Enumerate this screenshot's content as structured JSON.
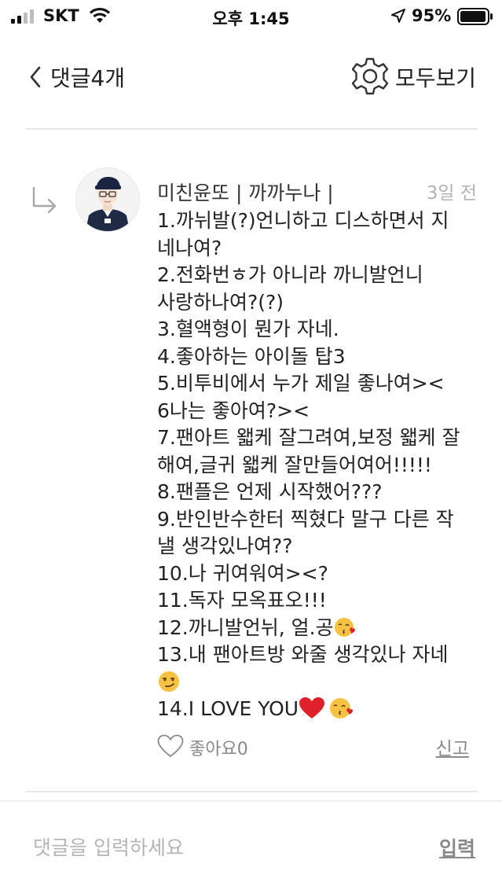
{
  "status_bar": {
    "carrier": "SKT",
    "time": "오후 1:45",
    "battery": "95%"
  },
  "header": {
    "title": "댓글4개",
    "view_all": "모두보기"
  },
  "comment": {
    "author": "미친윤또 | 까까누나 |",
    "time": "3일 전",
    "lines": [
      "1.까뉘발(?)언니하고 디스하면서 지",
      "네나여?",
      "2.전화번ㅎ가 아니라 까니발언니",
      "사랑하나여?(?)",
      "3.혈액형이 뭔가 자네.",
      "4.좋아하는 아이돌 탑3",
      "5.비투비에서 누가 제일 좋나여><",
      "6나는 좋아여?><",
      "7.팬아트 왧케 잘그려여,보정 왧케 잘",
      "해여,글귀 왧케 잘만들어여어!!!!!",
      "8.팬플은 언제 시작했어???",
      "9.반인반수한터 찍혔다 말구 다른 작",
      "낼 생각있나여??",
      "10.나 귀여워여><?",
      "11.독자 모옥표오!!!",
      "12.까니발언뉘, 얼.공",
      "13.내 팬아트방 와줄 생각있나 자네",
      "",
      "14.I LOVE YOU"
    ],
    "like_label": "좋아요0",
    "report_label": "신고"
  },
  "input": {
    "placeholder": "댓글을 입력하세요",
    "submit_label": "입력"
  },
  "colors": {
    "divider": "#e8e8e8",
    "muted_text": "#8a8a8a",
    "heart": "#e0202a",
    "emoji_face": "#f7c242"
  }
}
